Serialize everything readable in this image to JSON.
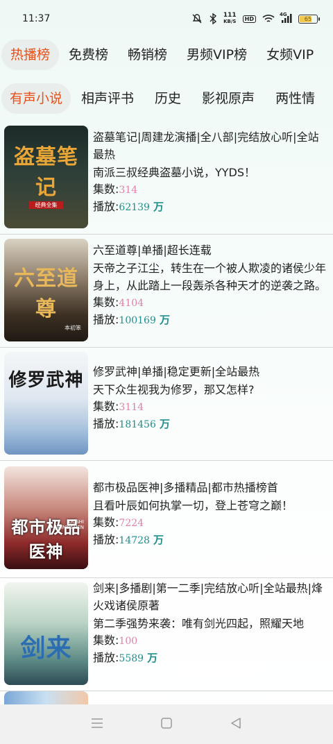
{
  "status": {
    "time": "11:37",
    "net_speed_value": "111",
    "net_speed_unit": "KB/S",
    "hd_label": "HD",
    "signal_label": "4G",
    "battery": "65"
  },
  "category_tabs": [
    {
      "label": "热播榜",
      "active": true
    },
    {
      "label": "免费榜",
      "active": false
    },
    {
      "label": "畅销榜",
      "active": false
    },
    {
      "label": "男频VIP榜",
      "active": false
    },
    {
      "label": "女频VIP",
      "active": false
    }
  ],
  "genre_tabs": [
    {
      "label": "有声小说",
      "active": true
    },
    {
      "label": "相声评书",
      "active": false
    },
    {
      "label": "历史",
      "active": false
    },
    {
      "label": "影视原声",
      "active": false
    },
    {
      "label": "两性情",
      "active": false
    }
  ],
  "labels": {
    "episodes": "集数:",
    "plays": "播放:",
    "unit": "万"
  },
  "items": [
    {
      "cover_text": "盗墓笔记",
      "cover_subtext": "经典全集",
      "title": "盗墓笔记|周建龙演播|全八部|完结放心听|全站最热",
      "description": "南派三叔经典盗墓小说，YYDS！",
      "episodes": "314",
      "plays": "62139"
    },
    {
      "cover_text": "六至道尊",
      "cover_subtext": "本初笨",
      "title": "六至道尊|单播|超长连载",
      "description": "天帝之子江尘，转生在一个被人欺凌的诸侯少年身上，从此踏上一段轰杀各种天才的逆袭之路。",
      "episodes": "4104",
      "plays": "100169"
    },
    {
      "cover_text": "修罗武神",
      "cover_subtext": "",
      "title": "修罗武神|单播|稳定更新|全站最热",
      "description": "天下众生视我为修罗，那又怎样?",
      "episodes": "3114",
      "plays": "181456"
    },
    {
      "cover_text": "都市极品医神",
      "cover_subtext": "DUSHI JIPINYISHEN",
      "title": "都市极品医神|多播精品|都市热播榜首",
      "description": "且看叶辰如何执掌一切，登上苍穹之巅！",
      "episodes": "7224",
      "plays": "14728"
    },
    {
      "cover_text": "剑来",
      "cover_subtext": "",
      "title": "剑来|多播剧|第一二季|完结放心听|全站最热|烽火戏诸侯原著",
      "description": "第二季强势来袭：唯有剑光四起，照耀天地",
      "episodes": "100",
      "plays": "5589"
    }
  ],
  "colors": {
    "accent": "#e8501b",
    "episodes": "#e27fa9",
    "plays": "#1f8f8d"
  },
  "nav": {
    "menu_icon": "menu-icon",
    "home_icon": "home-icon",
    "back_icon": "back-icon"
  }
}
